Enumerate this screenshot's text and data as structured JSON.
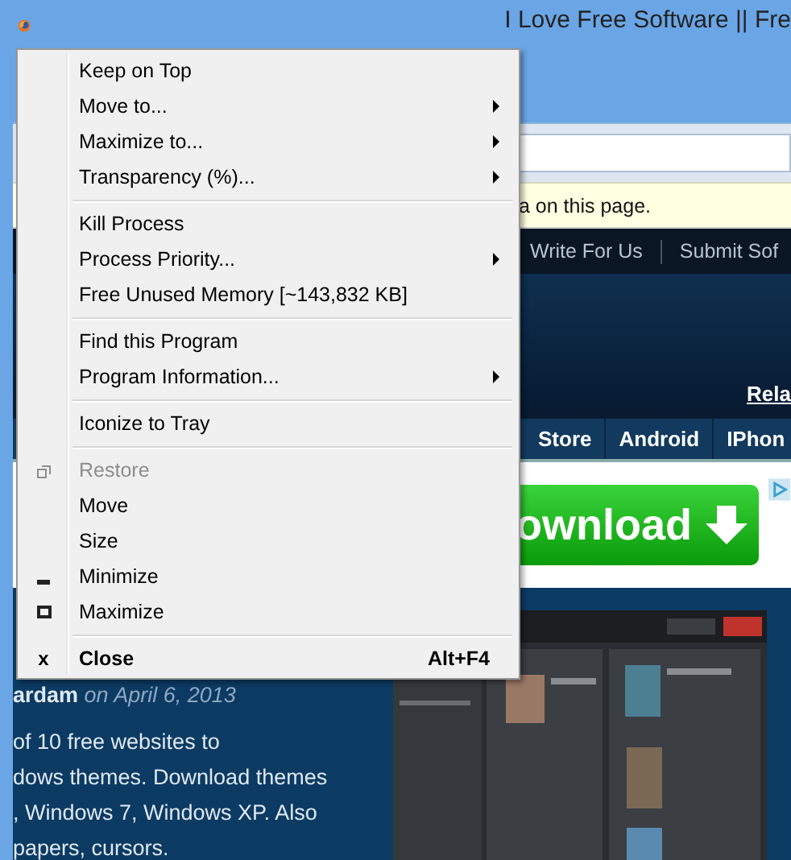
{
  "browser": {
    "title": "I Love Free Software || Fre",
    "notification": "a on this page.",
    "nav_links": [
      "Write For Us",
      "Submit Sof"
    ],
    "header_link": "Rela",
    "categories": [
      "Store",
      "Android",
      "IPhon"
    ],
    "ad": {
      "text": "ownload"
    },
    "article": {
      "author": "ardam",
      "date": "on April 6, 2013",
      "lines": [
        "of 10 free websites to",
        "dows themes. Download themes",
        ", Windows 7, Windows XP. Also",
        "papers, cursors."
      ]
    },
    "screenshot": {
      "kind": "picture"
    }
  },
  "menu": {
    "items": [
      {
        "kind": "item",
        "label": "Keep on Top",
        "disabled": false,
        "default": false
      },
      {
        "kind": "submenu",
        "label": "Move to...",
        "disabled": false,
        "default": false
      },
      {
        "kind": "submenu",
        "label": "Maximize to...",
        "disabled": false,
        "default": false
      },
      {
        "kind": "submenu",
        "label": "Transparency (%)...",
        "disabled": false,
        "default": false
      },
      {
        "kind": "separator"
      },
      {
        "kind": "item",
        "label": "Kill Process",
        "disabled": false,
        "default": false
      },
      {
        "kind": "submenu",
        "label": "Process Priority...",
        "disabled": false,
        "default": false
      },
      {
        "kind": "item",
        "label": "Free Unused Memory [~143,832 KB]",
        "disabled": false,
        "default": false
      },
      {
        "kind": "separator"
      },
      {
        "kind": "item",
        "label": "Find this Program",
        "disabled": false,
        "default": false
      },
      {
        "kind": "submenu",
        "label": "Program Information...",
        "disabled": false,
        "default": false
      },
      {
        "kind": "separator"
      },
      {
        "kind": "item",
        "label": "Iconize to Tray",
        "disabled": false,
        "default": false
      },
      {
        "kind": "separator"
      },
      {
        "kind": "restore",
        "label": "Restore",
        "disabled": true,
        "default": false
      },
      {
        "kind": "item",
        "label": "Move",
        "disabled": false,
        "default": false
      },
      {
        "kind": "item",
        "label": "Size",
        "disabled": false,
        "default": false
      },
      {
        "kind": "minimize",
        "label": "Minimize",
        "disabled": false,
        "default": false
      },
      {
        "kind": "maximize",
        "label": "Maximize",
        "disabled": false,
        "default": false
      },
      {
        "kind": "separator"
      },
      {
        "kind": "close",
        "icon": "x",
        "label": "Close",
        "shortcut": "Alt+F4",
        "disabled": false,
        "default": true
      }
    ]
  }
}
